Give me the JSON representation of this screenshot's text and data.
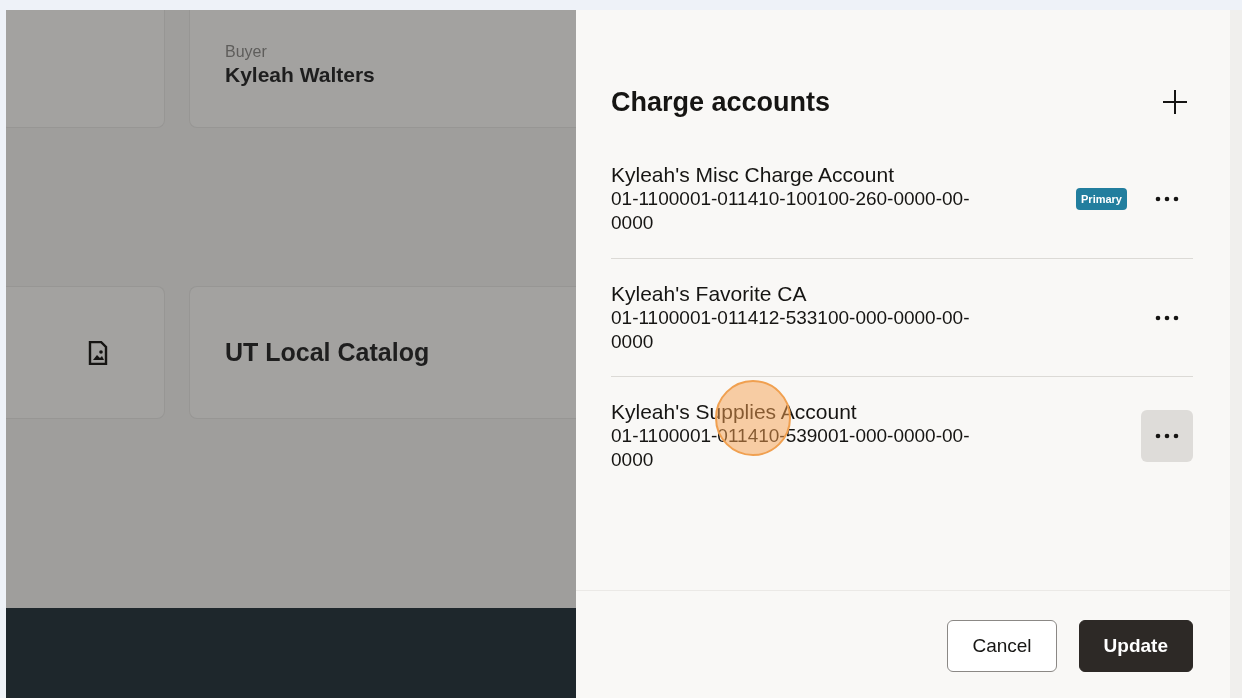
{
  "background": {
    "buyer_card": {
      "label": "Buyer",
      "value": "Kyleah Walters"
    },
    "catalog_card": {
      "title": "UT Local Catalog"
    }
  },
  "panel": {
    "title": "Charge accounts",
    "accounts": [
      {
        "name": "Kyleah's Misc Charge Account",
        "number": "01-1100001-011410-100100-260-0000-00-0000",
        "badge": "Primary",
        "highlighted": false
      },
      {
        "name": "Kyleah's Favorite CA",
        "number": "01-1100001-011412-533100-000-0000-00-0000",
        "highlighted": false
      },
      {
        "name": "Kyleah's Supplies Account",
        "number": "01-1100001-011410-539001-000-0000-00-0000",
        "highlighted": true
      }
    ],
    "buttons": [
      {
        "label": "Cancel",
        "kind": "secondary"
      },
      {
        "label": "Update",
        "kind": "primary"
      }
    ]
  }
}
